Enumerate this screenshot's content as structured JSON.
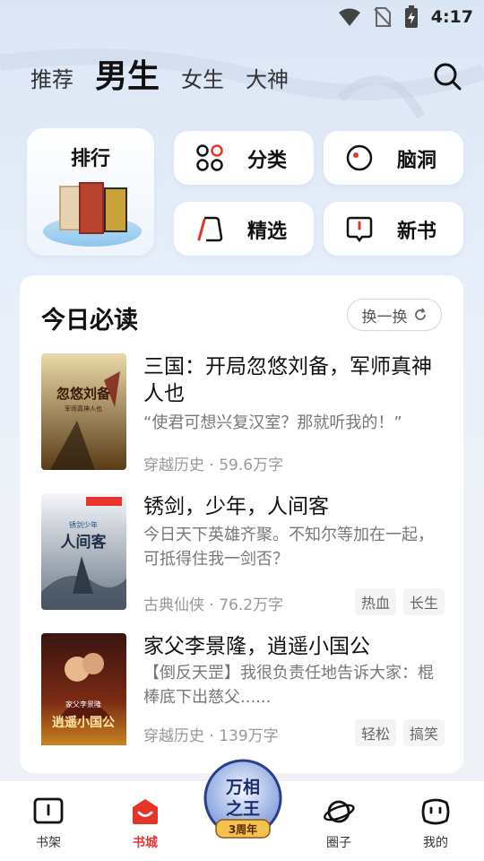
{
  "status_bar": {
    "time": "4:17",
    "icons": [
      "wifi-icon",
      "no-sim-icon",
      "battery-charging-icon"
    ]
  },
  "top_tabs": [
    {
      "label": "推荐",
      "active": false
    },
    {
      "label": "男生",
      "active": true
    },
    {
      "label": "女生",
      "active": false
    },
    {
      "label": "大神",
      "active": false
    }
  ],
  "categories": {
    "rank": "排行",
    "classify": "分类",
    "brainhole": "脑洞",
    "featured": "精选",
    "newbook": "新书"
  },
  "daily": {
    "title": "今日必读",
    "refresh_label": "换一换",
    "books": [
      {
        "title": "三国：开局忽悠刘备，军师真神人也",
        "desc": "“使君可想兴复汉室？那就听我的！”",
        "genre": "穿越历史",
        "words": "59.6万字",
        "tags": [],
        "cover_text": "忽悠刘备",
        "cover_sub": "军师真神人也"
      },
      {
        "title": "锈剑，少年，人间客",
        "desc": "今日天下英雄齐聚。不知尔等加在一起，可抵得住我一剑否？",
        "genre": "古典仙侠",
        "words": "76.2万字",
        "tags": [
          "热血",
          "长生"
        ],
        "cover_text": "人间客",
        "cover_sub": "锈剑少年"
      },
      {
        "title": "家父李景隆，逍遥小国公",
        "desc": "【倒反天罡】我很负责任地告诉大家：棍棒底下出慈父......",
        "genre": "穿越历史",
        "words": "139万字",
        "tags": [
          "轻松",
          "搞笑"
        ],
        "cover_text": "逍遥小国公",
        "cover_sub": "家父李景隆"
      }
    ]
  },
  "bottom_nav": [
    {
      "label": "书架",
      "icon": "bookshelf-icon",
      "active": false
    },
    {
      "label": "书城",
      "icon": "bookstore-icon",
      "active": true
    },
    {
      "label": "圈子",
      "icon": "planet-icon",
      "active": false
    },
    {
      "label": "我的",
      "icon": "profile-face-icon",
      "active": false
    }
  ],
  "center_badge": {
    "line1": "万相",
    "line2": "之王",
    "ribbon": "3周年"
  },
  "colors": {
    "accent_red": "#e5352b",
    "text_primary": "#111111",
    "text_secondary": "#777777",
    "tag_bg": "#f3f4f6"
  }
}
